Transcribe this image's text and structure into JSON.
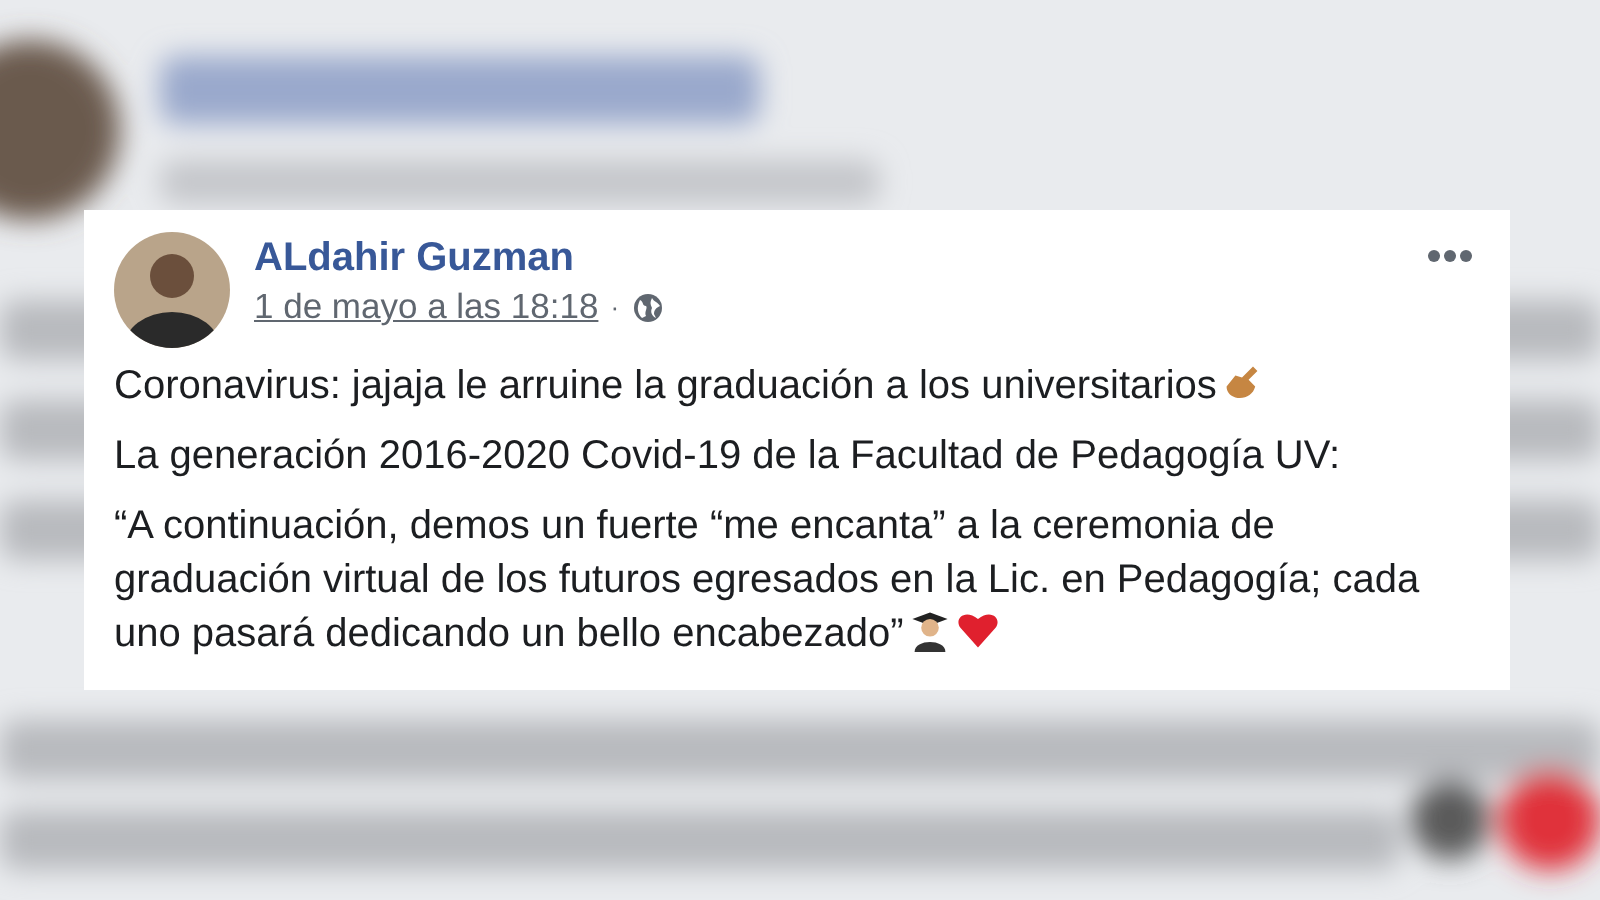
{
  "post": {
    "author": "ALdahir Guzman",
    "timestamp": "1 de mayo a las 18:18",
    "separator": "·",
    "paragraphs": [
      {
        "text": "Coronavirus: jajaja le arruine la graduación a los universitarios",
        "icons": [
          {
            "kind": "hand"
          }
        ]
      },
      {
        "text": "La generación 2016-2020 Covid-19 de la Facultad de Pedagogía UV:"
      },
      {
        "text": "“A continuación, demos un fuerte “me encanta” a la ceremonia de graduación virtual de los futuros egresados en la Lic. en Pedagogía; cada uno pasará dedicando un bello encabezado”",
        "icons": [
          {
            "kind": "graduate"
          },
          {
            "kind": "heart"
          }
        ]
      }
    ]
  }
}
